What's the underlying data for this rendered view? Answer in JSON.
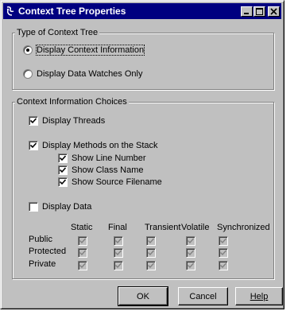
{
  "window": {
    "title": "Context Tree Properties",
    "controls": [
      "minimize-icon",
      "maximize-icon",
      "close-icon"
    ]
  },
  "type_group": {
    "legend": "Type of Context Tree",
    "options": [
      {
        "label": "Display Context Information",
        "selected": true
      },
      {
        "label": "Display Data Watches Only",
        "selected": false
      }
    ]
  },
  "choices_group": {
    "legend": "Context Information Choices",
    "display_threads": {
      "label": "Display Threads",
      "checked": true
    },
    "display_methods": {
      "label": "Display Methods on the Stack",
      "checked": true
    },
    "sub_options": [
      {
        "label": "Show Line Number",
        "checked": true
      },
      {
        "label": "Show Class Name",
        "checked": true
      },
      {
        "label": "Show Source Filename",
        "checked": true
      }
    ],
    "display_data": {
      "label": "Display Data",
      "checked": false
    },
    "modifier_columns": [
      "Static",
      "Final",
      "Transient",
      "Volatile",
      "Synchronized"
    ],
    "access_rows": [
      "Public",
      "Protected",
      "Private"
    ],
    "grid_state": "disabled-checked"
  },
  "buttons": {
    "ok": "OK",
    "cancel": "Cancel",
    "help": "Help"
  }
}
